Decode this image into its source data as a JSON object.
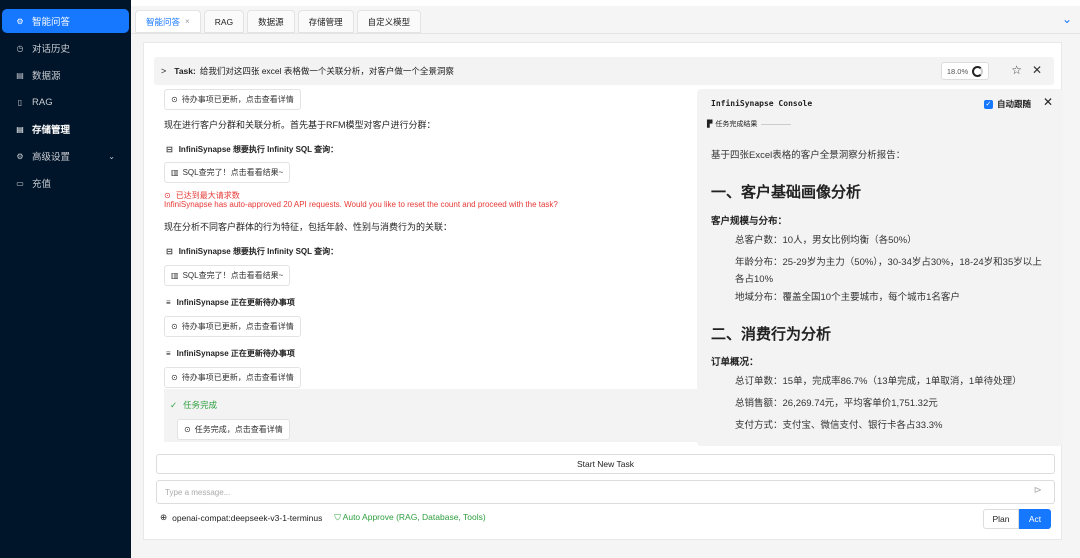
{
  "sidebar": {
    "items": [
      {
        "label": "智能问答",
        "icon": "chat-icon"
      },
      {
        "label": "对话历史",
        "icon": "history-icon"
      },
      {
        "label": "数据源",
        "icon": "database-icon"
      },
      {
        "label": "RAG",
        "icon": "document-icon"
      },
      {
        "label": "存储管理",
        "icon": "storage-icon"
      },
      {
        "label": "高级设置",
        "icon": "gear-icon"
      },
      {
        "label": "充值",
        "icon": "wallet-icon"
      }
    ]
  },
  "tabs": [
    {
      "label": "智能问答"
    },
    {
      "label": "RAG"
    },
    {
      "label": "数据源"
    },
    {
      "label": "存储管理"
    },
    {
      "label": "自定义模型"
    }
  ],
  "task": {
    "prefix": "Task:",
    "text": "给我们对这四张 excel 表格做一个关联分析，对客户做一个全景洞察",
    "progress": "18.0%"
  },
  "chat": {
    "todo_updated": "待办事项已更新，点击查看详情",
    "msg1": "现在进行客户分群和关联分析。首先基于RFM模型对客户进行分群：",
    "sql_request": "InfiniSynapse 想要执行 Infinity SQL 查询：",
    "sql_done": "SQL查完了！点击看看结果~",
    "limit_title": "已达到最大请求数",
    "limit_msg": "InfiniSynapse has auto-approved 20 API requests. Would you like to reset the count and proceed with the task?",
    "msg2": "现在分析不同客户群体的行为特征，包括年龄、性别与消费行为的关联：",
    "todo_updating": "InfiniSynapse 正在更新待办事项",
    "task_complete": "任务完成",
    "task_complete_details": "任务完成，点击查看详情"
  },
  "console": {
    "title": "InfiniSynapse Console",
    "auto_follow": "自动跟随",
    "section": "任务完成结果",
    "intro": "基于四张Excel表格的客户全景洞察分析报告：",
    "h1_a": "一、客户基础画像分析",
    "h3_a": "客户规模与分布：",
    "p_a1": "总客户数：10人，男女比例均衡（各50%）",
    "p_a2": "年龄分布：25-29岁为主力（50%），30-34岁占30%，18-24岁和35岁以上各占10%",
    "p_a3": "地域分布：覆盖全国10个主要城市，每个城市1名客户",
    "h1_b": "二、消费行为分析",
    "h3_b": "订单概况：",
    "p_b1": "总订单数：15单，完成率86.7%（13单完成，1单取消，1单待处理）",
    "p_b2": "总销售额：26,269.74元，平均客单价1,751.32元",
    "p_b3": "支付方式：支付宝、微信支付、银行卡各占33.3%"
  },
  "bottom": {
    "start_new_task": "Start New Task",
    "message_placeholder": "Type a message...",
    "model": "openai-compat:deepseek-v3-1-terminus",
    "auto_approve": "Auto Approve (RAG, Database, Tools)",
    "plan": "Plan",
    "act": "Act"
  },
  "colors": {
    "accent": "#1677ff",
    "sidebar_bg": "#001529",
    "error": "#e53935",
    "success": "#2e9e3f"
  }
}
